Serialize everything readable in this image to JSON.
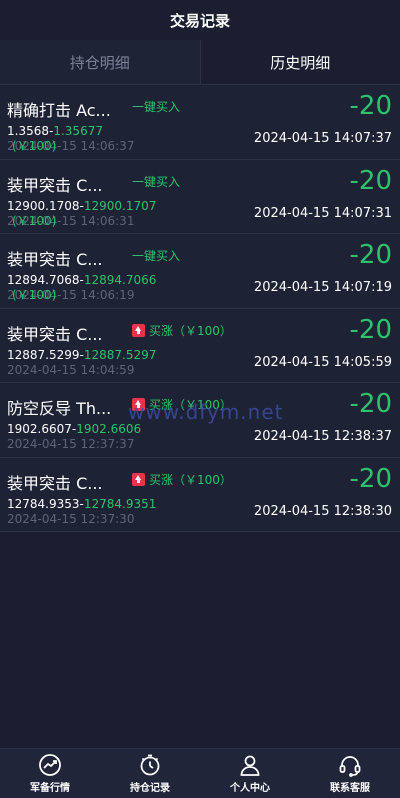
{
  "header": {
    "title": "交易记录"
  },
  "tabs": [
    {
      "label": "持仓明细",
      "active": false
    },
    {
      "label": "历史明细",
      "active": true
    }
  ],
  "records": [
    {
      "title": "精确打击 Ac...",
      "tag": "一键买入",
      "tag_icon": "",
      "open_price": "1.3568",
      "close_price": "1.35677",
      "amount_note": "(￥100)",
      "open_time": "2024-04-15 14:06:37",
      "profit": "-20",
      "close_time": "2024-04-15 14:07:37"
    },
    {
      "title": "装甲突击 C...",
      "tag": "一键买入",
      "tag_icon": "",
      "open_price": "12900.1708",
      "close_price": "12900.1707",
      "amount_note": "(￥100)",
      "open_time": "2024-04-15 14:06:31",
      "profit": "-20",
      "close_time": "2024-04-15 14:07:31"
    },
    {
      "title": "装甲突击 C...",
      "tag": "一键买入",
      "tag_icon": "",
      "open_price": "12894.7068",
      "close_price": "12894.7066",
      "amount_note": "(￥100)",
      "open_time": "2024-04-15 14:06:19",
      "profit": "-20",
      "close_time": "2024-04-15 14:07:19"
    },
    {
      "title": "装甲突击 C...",
      "tag": "买涨（￥100）",
      "tag_icon": "up-arrow-icon",
      "open_price": "12887.5299",
      "close_price": "12887.5297",
      "amount_note": "",
      "open_time": "2024-04-15 14:04:59",
      "profit": "-20",
      "close_time": "2024-04-15 14:05:59"
    },
    {
      "title": "防空反导 Th...",
      "tag": "买涨（￥100）",
      "tag_icon": "up-arrow-icon",
      "open_price": "1902.6607",
      "close_price": "1902.6606",
      "amount_note": "",
      "open_time": "2024-04-15 12:37:37",
      "profit": "-20",
      "close_time": "2024-04-15 12:38:37"
    },
    {
      "title": "装甲突击 C...",
      "tag": "买涨（￥100）",
      "tag_icon": "up-arrow-icon",
      "open_price": "12784.9353",
      "close_price": "12784.9351",
      "amount_note": "",
      "open_time": "2024-04-15 12:37:30",
      "profit": "-20",
      "close_time": "2024-04-15 12:38:30"
    }
  ],
  "watermark": "www.dfym.net",
  "bottom_nav": [
    {
      "label": "军备行情",
      "icon": "chart-trend-icon"
    },
    {
      "label": "持仓记录",
      "icon": "stopwatch-icon"
    },
    {
      "label": "个人中心",
      "icon": "user-icon"
    },
    {
      "label": "联系客服",
      "icon": "headset-icon"
    }
  ],
  "colors": {
    "background": "#1a1e30",
    "profit_green": "#2ec26a",
    "up_red": "#e8334a",
    "muted": "#5e6478"
  }
}
